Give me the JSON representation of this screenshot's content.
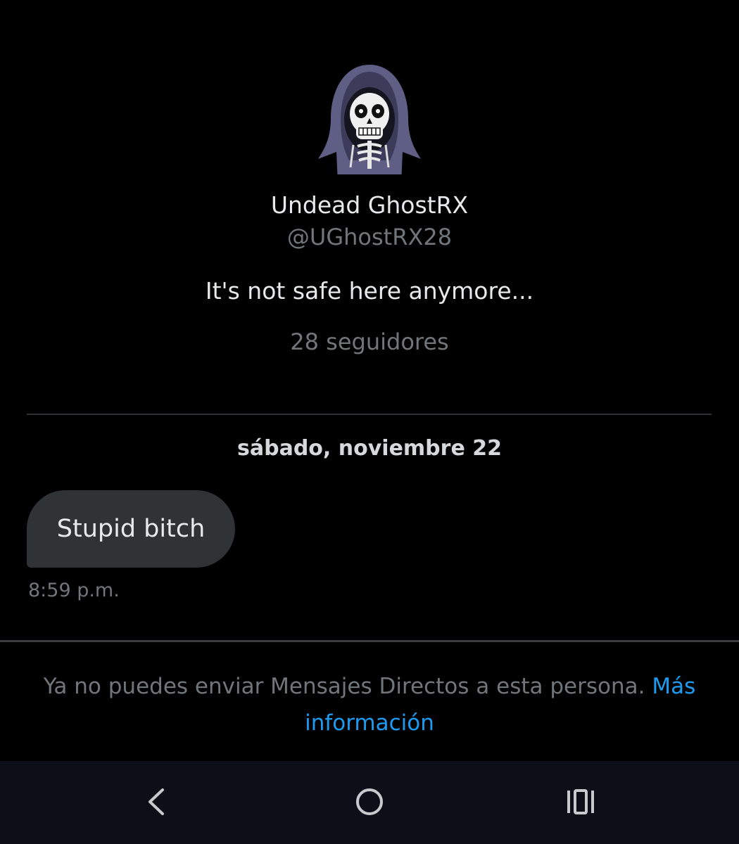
{
  "profile": {
    "display_name": "Undead GhostRX",
    "handle": "@UGhostRX28",
    "bio": "It's not safe here anymore...",
    "followers": "28 seguidores",
    "avatar_icon": "hooded-skull-icon"
  },
  "conversation": {
    "date_separator": "sábado, noviembre 22",
    "messages": [
      {
        "text": "Stupid bitch",
        "time": "8:59 p.m."
      }
    ]
  },
  "footer_notice": {
    "text": "Ya no puedes enviar Mensajes Directos a esta persona. ",
    "link_text": "Más información"
  },
  "navigation": {
    "back_icon": "chevron-left-icon",
    "home_icon": "circle-home-icon",
    "recents_icon": "recent-apps-icon"
  },
  "colors": {
    "background": "#000000",
    "bubble": "#2f3336",
    "muted_text": "#71767b",
    "link": "#1d9bf0",
    "navbar": "#0c0f17"
  }
}
